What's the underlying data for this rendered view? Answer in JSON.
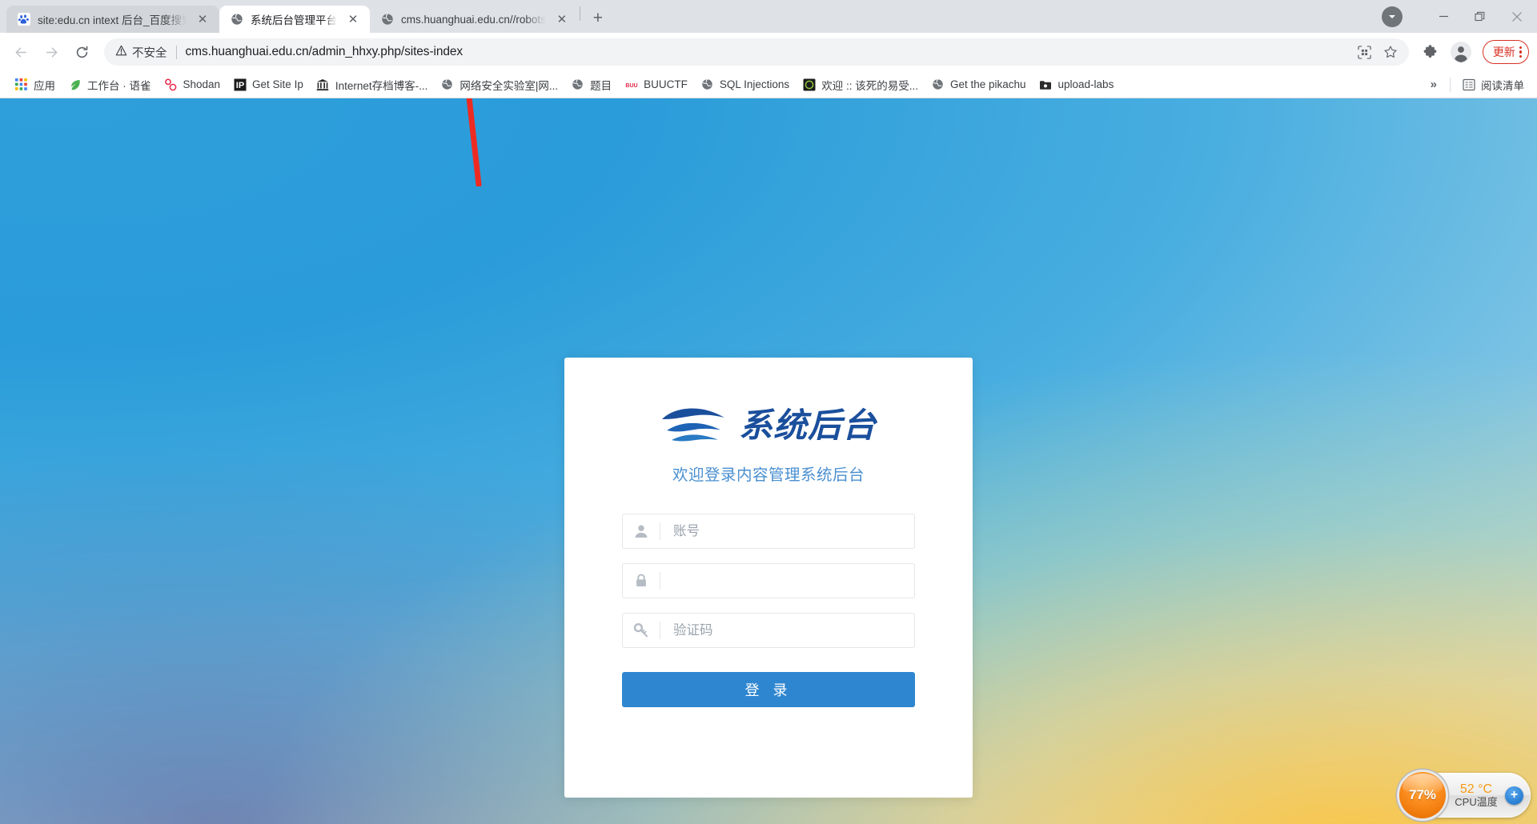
{
  "browser": {
    "tabs": [
      {
        "title": "site:edu.cn intext 后台_百度搜索",
        "favicon": "baidu-paw-icon",
        "active": false,
        "close_label": "✕"
      },
      {
        "title": "系统后台管理平台",
        "favicon": "globe-icon",
        "active": true,
        "close_label": "✕"
      },
      {
        "title": "cms.huanghuai.edu.cn//robots",
        "favicon": "globe-icon",
        "active": false,
        "close_label": "✕"
      }
    ],
    "new_tab_label": "+",
    "window_controls": {
      "download_label": "▼",
      "minimize_label": "—",
      "maximize_label": "❐",
      "close_label": "✕"
    },
    "toolbar": {
      "back_label": "←",
      "forward_label": "→",
      "reload_label": "⟳",
      "security_label": "不安全",
      "security_icon": "warning-triangle-icon",
      "url": "cms.huanghuai.edu.cn/admin_hhxy.php/sites-index",
      "qr_icon": "qr-code-icon",
      "bookmark_star_icon": "star-icon",
      "extensions_icon": "puzzle-piece-icon",
      "profile_icon": "user-avatar-icon",
      "update_label": "更新",
      "menu_icon": "three-dots-vertical-icon",
      "update_accent": "#d93025"
    },
    "bookmarks": [
      {
        "label": "应用",
        "icon": "apps-grid-icon"
      },
      {
        "label": "工作台 · 语雀",
        "icon": "yuque-leaf-icon"
      },
      {
        "label": "Shodan",
        "icon": "shodan-icon"
      },
      {
        "label": "Get Site Ip",
        "icon": "ip-icon"
      },
      {
        "label": "Internet存档博客-...",
        "icon": "archive-icon"
      },
      {
        "label": "网络安全实验室|网...",
        "icon": "globe-icon"
      },
      {
        "label": "题目",
        "icon": "globe-icon"
      },
      {
        "label": "BUUCTF",
        "icon": "buuctf-icon"
      },
      {
        "label": "SQL Injections",
        "icon": "globe-icon"
      },
      {
        "label": "欢迎 :: 该死的易受...",
        "icon": "dvwa-icon"
      },
      {
        "label": "Get the pikachu",
        "icon": "globe-icon"
      },
      {
        "label": "upload-labs",
        "icon": "folder-icon"
      }
    ],
    "bookmarks_overflow_label": "»",
    "reading_list_label": "阅读清单",
    "reading_list_icon": "reading-list-icon"
  },
  "page": {
    "logo": {
      "text": "系统后台",
      "mark": "wave-swoosh-icon",
      "color": "#1a4f9c"
    },
    "subtitle": "欢迎登录内容管理系统后台",
    "fields": [
      {
        "name": "username",
        "icon": "person-icon",
        "placeholder": "账号",
        "value": ""
      },
      {
        "name": "password",
        "icon": "lock-icon",
        "placeholder": "",
        "value": ""
      },
      {
        "name": "captcha",
        "icon": "key-icon",
        "placeholder": "验证码",
        "value": ""
      }
    ],
    "login_button": "登 录",
    "accent_color": "#2f86d0"
  },
  "overlay": {
    "annotation": {
      "type": "red-arrow",
      "color": "#ee2b22",
      "points_to": "url"
    },
    "cpu_widget": {
      "percent": "77%",
      "temperature": "52 °C",
      "label": "CPU温度",
      "add_label": "+",
      "dial_color": "#f7870f",
      "temp_color": "#f79a12"
    }
  }
}
